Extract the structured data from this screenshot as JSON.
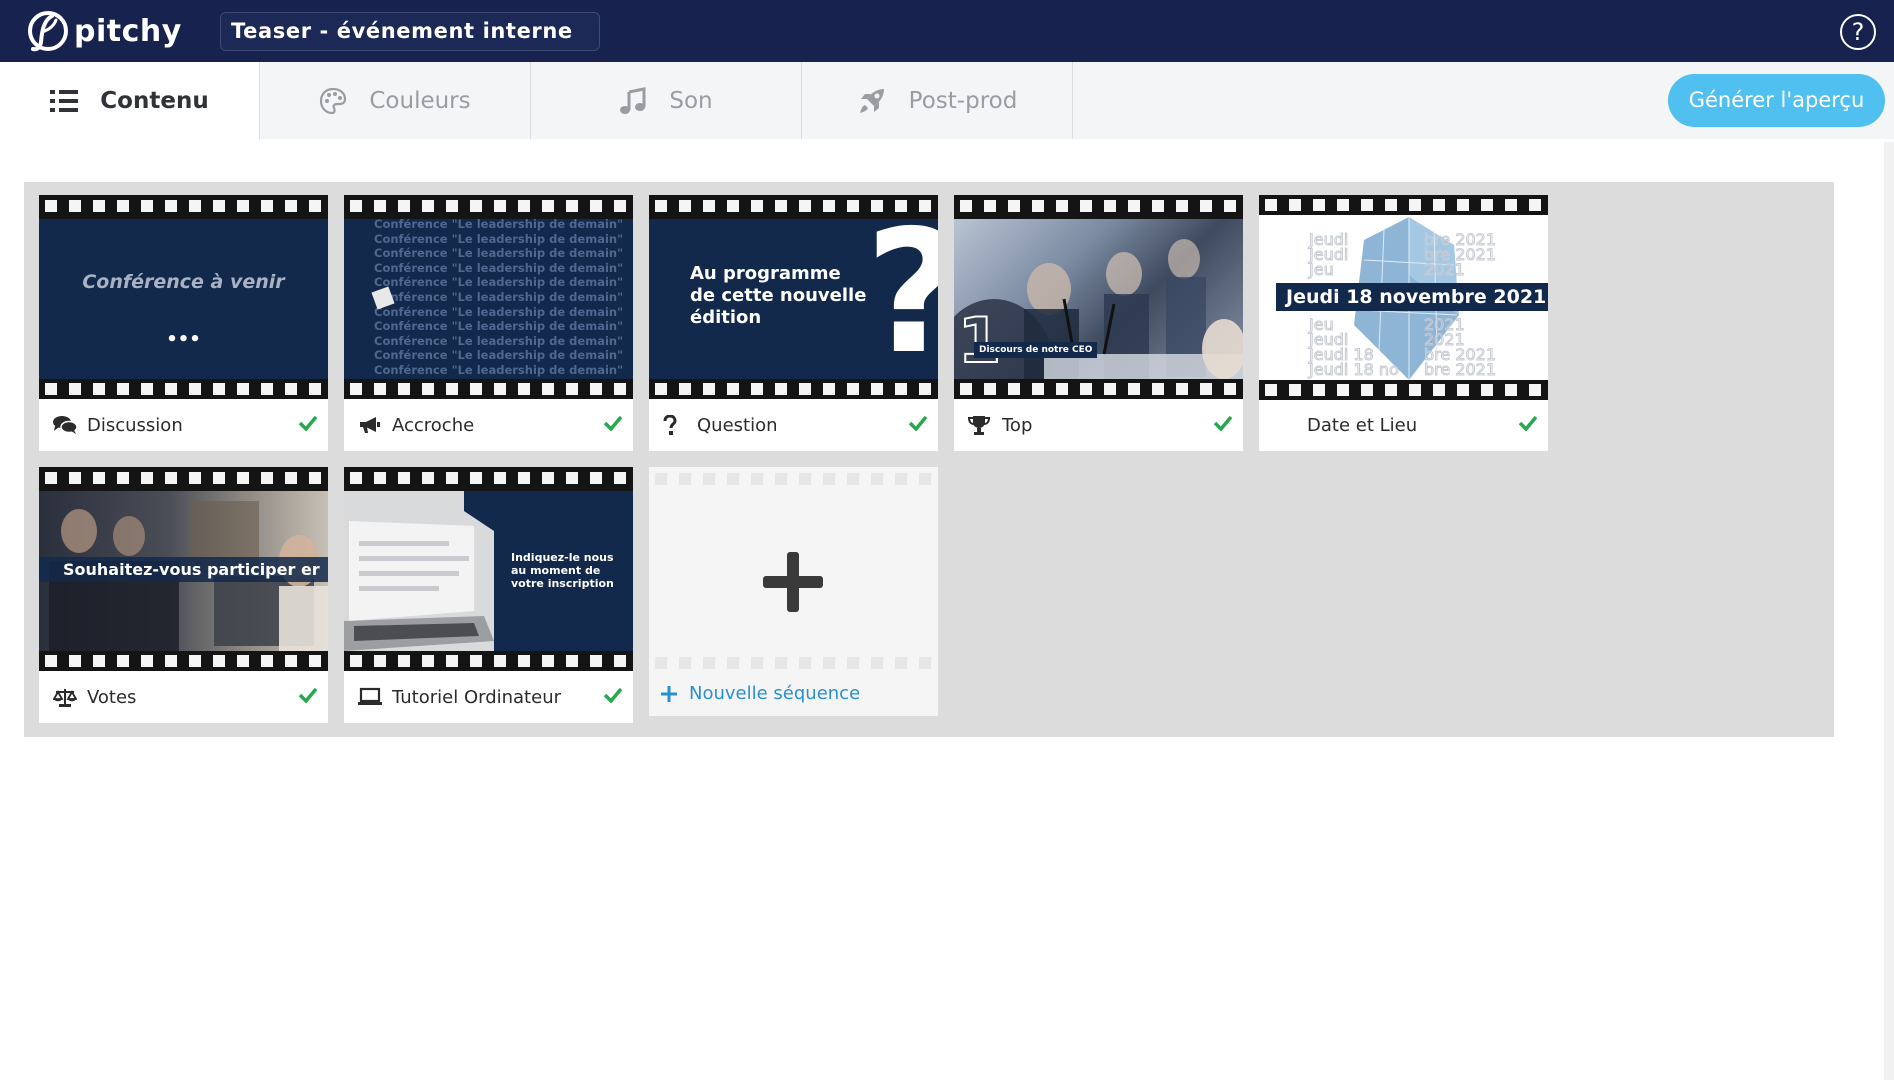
{
  "app": {
    "logo_text": "pitchy",
    "project_title": "Teaser - événement interne",
    "help_symbol": "?"
  },
  "tabs": [
    {
      "label": "Contenu",
      "icon": "list-icon",
      "active": true
    },
    {
      "label": "Couleurs",
      "icon": "palette-icon",
      "active": false
    },
    {
      "label": "Son",
      "icon": "music-note-icon",
      "active": false
    },
    {
      "label": "Post-prod",
      "icon": "rocket-icon",
      "active": false
    }
  ],
  "generate_button": "Générer l'aperçu",
  "sequences": [
    {
      "label": "Discussion",
      "icon": "comments-icon",
      "done": true,
      "thumb_title": "Conférence à venir",
      "thumb_dots": "•••"
    },
    {
      "label": "Accroche",
      "icon": "megaphone-icon",
      "done": true,
      "thumb_repeat_line": "Conférence \"Le leadership de demain\""
    },
    {
      "label": "Question",
      "icon": "question-icon",
      "done": true,
      "thumb_title": "Au programme de cette nouvelle édition",
      "thumb_mark": "?"
    },
    {
      "label": "Top",
      "icon": "trophy-icon",
      "done": true,
      "thumb_number": "1",
      "thumb_caption": "Discours de notre CEO"
    },
    {
      "label": "Date et Lieu",
      "icon": "none",
      "done": true,
      "thumb_title": "Jeudi 18 novembre 2021"
    },
    {
      "label": "Votes",
      "icon": "balance-scale-icon",
      "done": true,
      "thumb_title": "Souhaitez-vous participer er"
    },
    {
      "label": "Tutoriel Ordinateur",
      "icon": "laptop-icon",
      "done": true,
      "thumb_title": "Indiquez-le nous au moment de votre inscription"
    }
  ],
  "new_sequence": {
    "label": "Nouvelle séquence",
    "icon": "plus-icon"
  },
  "colors": {
    "topbar": "#17234e",
    "accent": "#4fc0ef",
    "check": "#27a84f",
    "link": "#2a8fd1",
    "thumb_navy": "#13294b"
  }
}
